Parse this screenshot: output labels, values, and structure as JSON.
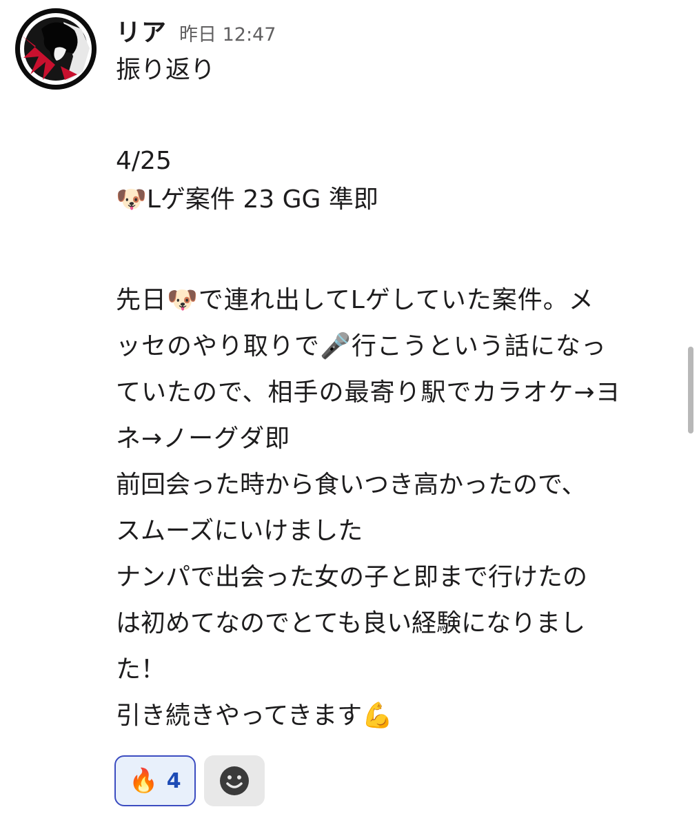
{
  "message": {
    "author": "リア",
    "timestamp": "昨日 12:47",
    "title_line": "振り返り",
    "date": "4/25",
    "summary": "Lゲ案件 23 GG 準即",
    "para1_lines": [
      "先日🐶で連れ出してLゲしていた案件。メ",
      "ッセのやり取りで🎤行こうという話になっ",
      "ていたので、相手の最寄り駅でカラオケ→ヨ",
      "ネ→ノーグダ即"
    ],
    "para2_lines": [
      "前回会った時から食いつき高かったので、",
      "スムーズにいけました",
      "ナンパで出会った女の子と即まで行けたの",
      "は初めてなのでとても良い経験になりまし",
      "た！",
      "引き続きやってきます💪"
    ]
  },
  "reactions": [
    {
      "emoji": "🔥",
      "count": "4"
    }
  ],
  "icons": {
    "summary_icon": "dog-face-icon",
    "add_reaction_icon": "smiley-icon"
  }
}
